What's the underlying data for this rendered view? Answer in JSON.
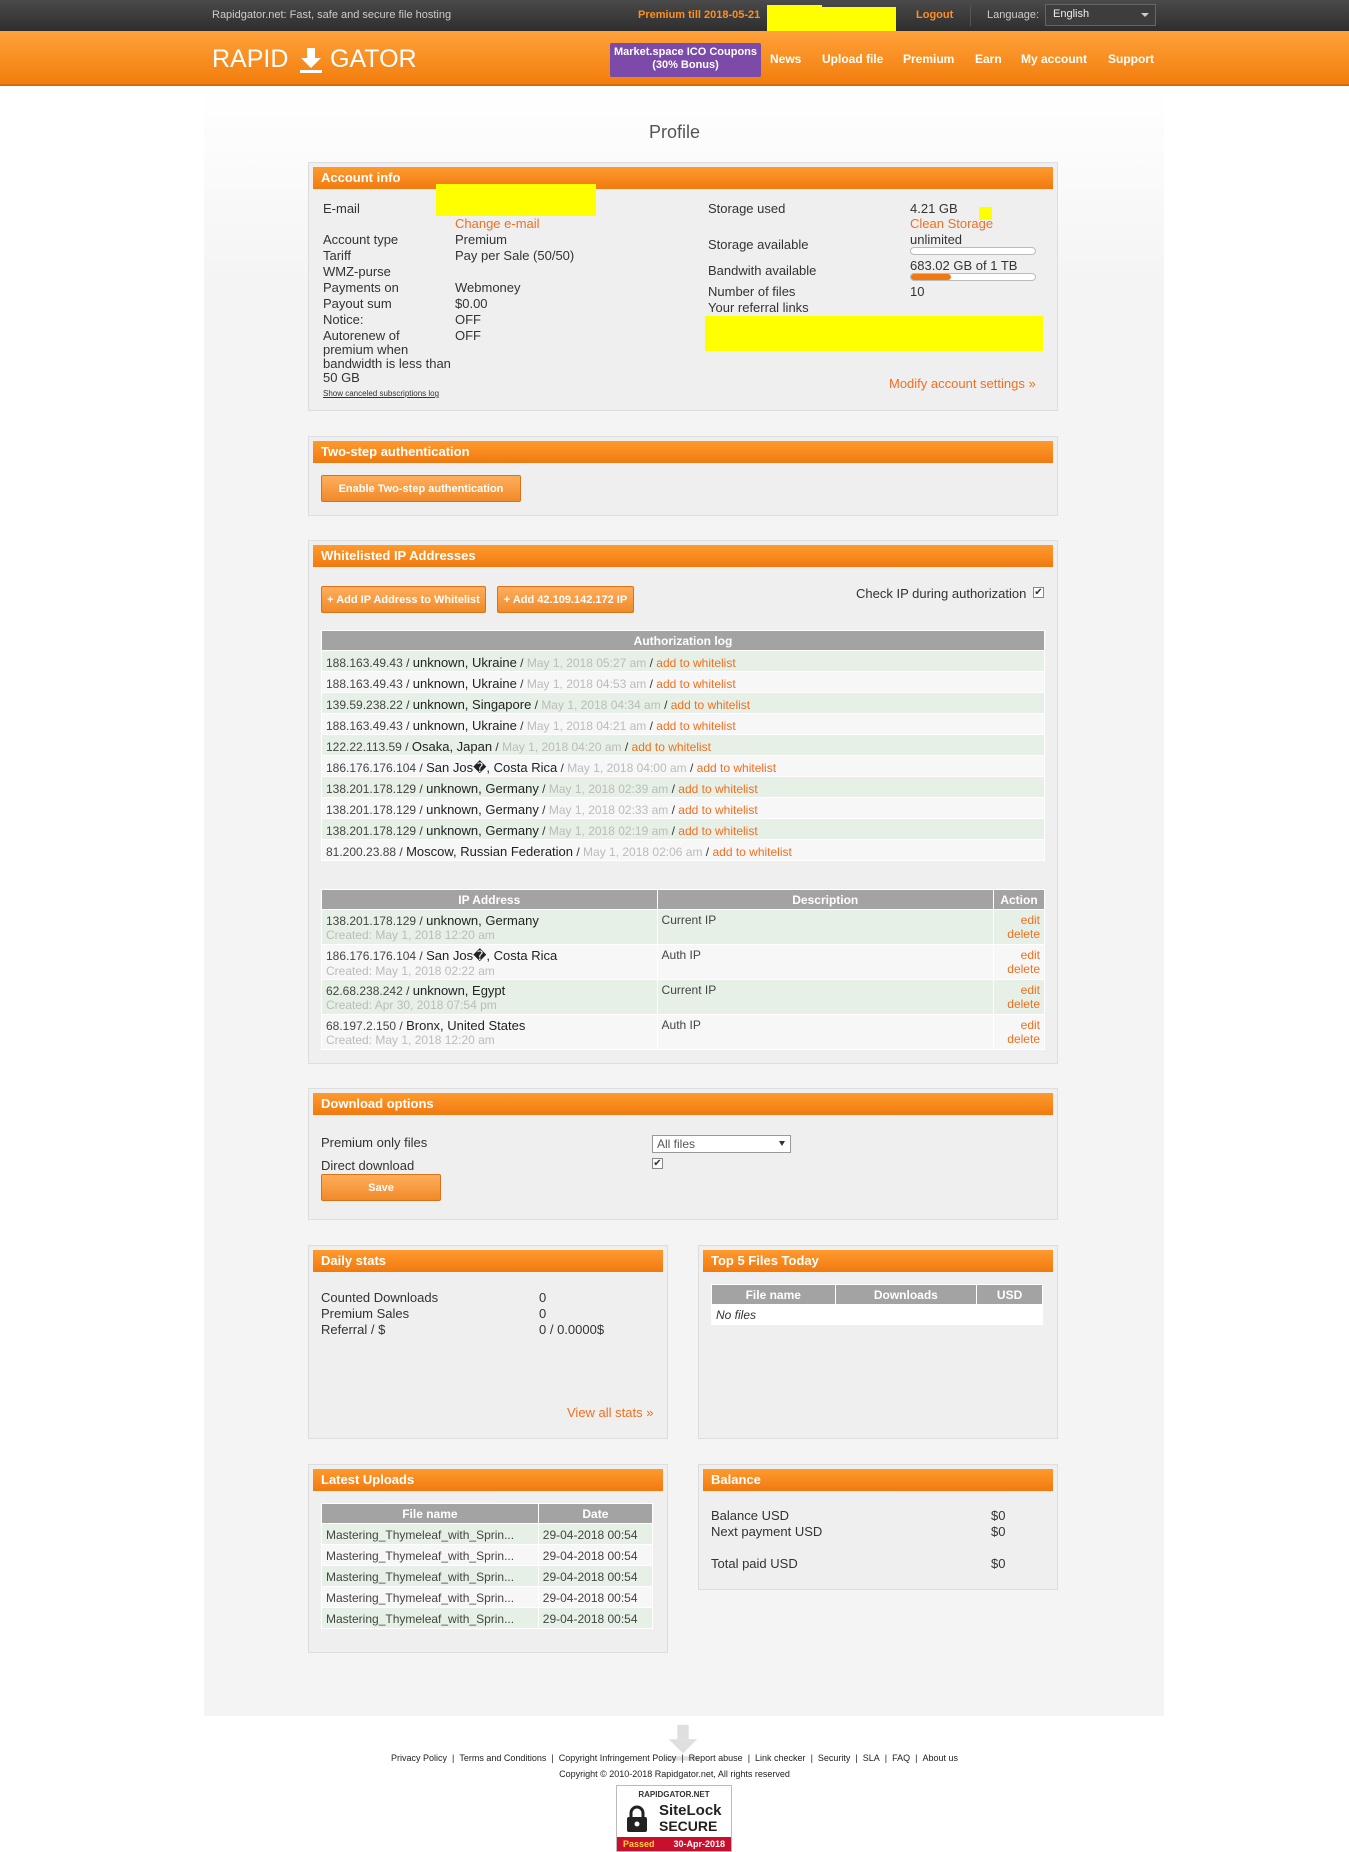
{
  "topbar": {
    "tagline": "Rapidgator.net: Fast, safe and secure file hosting",
    "premium": "Premium till 2018-05-21",
    "logout": "Logout",
    "language_label": "Language:",
    "language_value": "English"
  },
  "header": {
    "logo_left": "RAPID",
    "logo_right": "GATOR",
    "coupon_line1": "Market.space ICO Coupons",
    "coupon_line2": "(30% Bonus)",
    "nav": [
      "News",
      "Upload file",
      "Premium",
      "Earn",
      "My account",
      "Support"
    ]
  },
  "page_title": "Profile",
  "account": {
    "title": "Account info",
    "email_label": "E-mail",
    "change_email": "Change e-mail",
    "account_type_label": "Account type",
    "account_type": "Premium",
    "tariff_label": "Tariff",
    "tariff": "Pay per Sale (50/50)",
    "wmz_label": "WMZ-purse",
    "payments_label": "Payments on",
    "payments": "Webmoney",
    "payout_label": "Payout sum",
    "payout": "$0.00",
    "notice_label": "Notice:",
    "notice": "OFF",
    "autorenew_label_1": "Autorenew of",
    "autorenew_label_2": "premium when",
    "autorenew_label_3": "bandwidth is less than",
    "autorenew_label_4": "50 GB",
    "autorenew": "OFF",
    "canceled_log": "Show canceled subscriptions log",
    "storage_used_label": "Storage used",
    "storage_used": "4.21 GB",
    "clean_storage": "Clean Storage",
    "storage_available_label": "Storage available",
    "storage_available": "unlimited",
    "storage_fraction": 0,
    "bandwidth_label": "Bandwith available",
    "bandwidth": "683.02 GB of 1 TB",
    "bandwidth_fraction": 0.32,
    "files_label": "Number of files",
    "files": "10",
    "referral_label": "Your referral links",
    "modify": "Modify account settings »"
  },
  "twostep": {
    "title": "Two-step authentication",
    "button": "Enable Two-step authentication"
  },
  "whitelist": {
    "title": "Whitelisted IP Addresses",
    "add_button": "+ Add IP Address to Whitelist",
    "add_ip_button": "+ Add 42.109.142.172 IP",
    "check_label": "Check IP during authorization",
    "log_header": "Authorization log",
    "log": [
      {
        "ip": "188.163.49.43",
        "loc": "unknown, Ukraine",
        "date": "May 1, 2018 05:27 am",
        "action": "add to whitelist"
      },
      {
        "ip": "188.163.49.43",
        "loc": "unknown, Ukraine",
        "date": "May 1, 2018 04:53 am",
        "action": "add to whitelist"
      },
      {
        "ip": "139.59.238.22",
        "loc": "unknown, Singapore",
        "date": "May 1, 2018 04:34 am",
        "action": "add to whitelist"
      },
      {
        "ip": "188.163.49.43",
        "loc": "unknown, Ukraine",
        "date": "May 1, 2018 04:21 am",
        "action": "add to whitelist"
      },
      {
        "ip": "122.22.113.59",
        "loc": "Osaka, Japan",
        "date": "May 1, 2018 04:20 am",
        "action": "add to whitelist"
      },
      {
        "ip": "186.176.176.104",
        "loc": "San Jos�, Costa Rica",
        "date": "May 1, 2018 04:00 am",
        "action": "add to whitelist"
      },
      {
        "ip": "138.201.178.129",
        "loc": "unknown, Germany",
        "date": "May 1, 2018 02:39 am",
        "action": "add to whitelist"
      },
      {
        "ip": "138.201.178.129",
        "loc": "unknown, Germany",
        "date": "May 1, 2018 02:33 am",
        "action": "add to whitelist"
      },
      {
        "ip": "138.201.178.129",
        "loc": "unknown, Germany",
        "date": "May 1, 2018 02:19 am",
        "action": "add to whitelist"
      },
      {
        "ip": "81.200.23.88",
        "loc": "Moscow, Russian Federation",
        "date": "May 1, 2018 02:06 am",
        "action": "add to whitelist"
      }
    ],
    "ip_table_headers": [
      "IP Address",
      "Description",
      "Action"
    ],
    "ip_rows": [
      {
        "ip": "138.201.178.129",
        "loc": "unknown, Germany",
        "created": "Created: May 1, 2018 12:20 am",
        "desc": "Current IP",
        "edit": "edit",
        "delete": "delete"
      },
      {
        "ip": "186.176.176.104",
        "loc": "San Jos�, Costa Rica",
        "created": "Created: May 1, 2018 02:22 am",
        "desc": "Auth IP",
        "edit": "edit",
        "delete": "delete"
      },
      {
        "ip": "62.68.238.242",
        "loc": "unknown, Egypt",
        "created": "Created: Apr 30, 2018 07:54 pm",
        "desc": "Current IP",
        "edit": "edit",
        "delete": "delete"
      },
      {
        "ip": "68.197.2.150",
        "loc": "Bronx, United States",
        "created": "Created: May 1, 2018 12:20 am",
        "desc": "Auth IP",
        "edit": "edit",
        "delete": "delete"
      }
    ]
  },
  "download": {
    "title": "Download options",
    "premium_only_label": "Premium only files",
    "premium_only_value": "All files",
    "direct_label": "Direct download",
    "save": "Save"
  },
  "daily": {
    "title": "Daily stats",
    "counted_label": "Counted Downloads",
    "counted": "0",
    "sales_label": "Premium Sales",
    "sales": "0",
    "referral_label": "Referral / $",
    "referral": "0 / 0.0000$",
    "view_all": "View all stats »"
  },
  "top5": {
    "title": "Top 5 Files Today",
    "headers": [
      "File name",
      "Downloads",
      "USD"
    ],
    "empty": "No files"
  },
  "uploads": {
    "title": "Latest Uploads",
    "headers": [
      "File name",
      "Date"
    ],
    "rows": [
      {
        "name": "Mastering_Thymeleaf_with_Sprin...",
        "date": "29-04-2018 00:54"
      },
      {
        "name": "Mastering_Thymeleaf_with_Sprin...",
        "date": "29-04-2018 00:54"
      },
      {
        "name": "Mastering_Thymeleaf_with_Sprin...",
        "date": "29-04-2018 00:54"
      },
      {
        "name": "Mastering_Thymeleaf_with_Sprin...",
        "date": "29-04-2018 00:54"
      },
      {
        "name": "Mastering_Thymeleaf_with_Sprin...",
        "date": "29-04-2018 00:54"
      }
    ]
  },
  "balance": {
    "title": "Balance",
    "balance_label": "Balance USD",
    "balance": "$0",
    "next_label": "Next payment USD",
    "next": "$0",
    "total_label": "Total paid USD",
    "total": "$0"
  },
  "footer": {
    "links": [
      "Privacy Policy",
      "Terms and Conditions",
      "Copyright Infringement Policy",
      "Report abuse",
      "Link checker",
      "Security",
      "SLA",
      "FAQ",
      "About us"
    ],
    "copyright": "Copyright © 2010-2018 Rapidgator.net, All rights reserved",
    "sitelock_site": "RAPIDGATOR.NET",
    "sitelock_brand": "SiteLock",
    "sitelock_secure": "SECURE",
    "sitelock_passed": "Passed",
    "sitelock_date": "30-Apr-2018"
  },
  "colors": {
    "accent": "#f07a10",
    "link": "#f26f1f",
    "redact": "#ffff00",
    "coupon": "#7c4aa8"
  }
}
